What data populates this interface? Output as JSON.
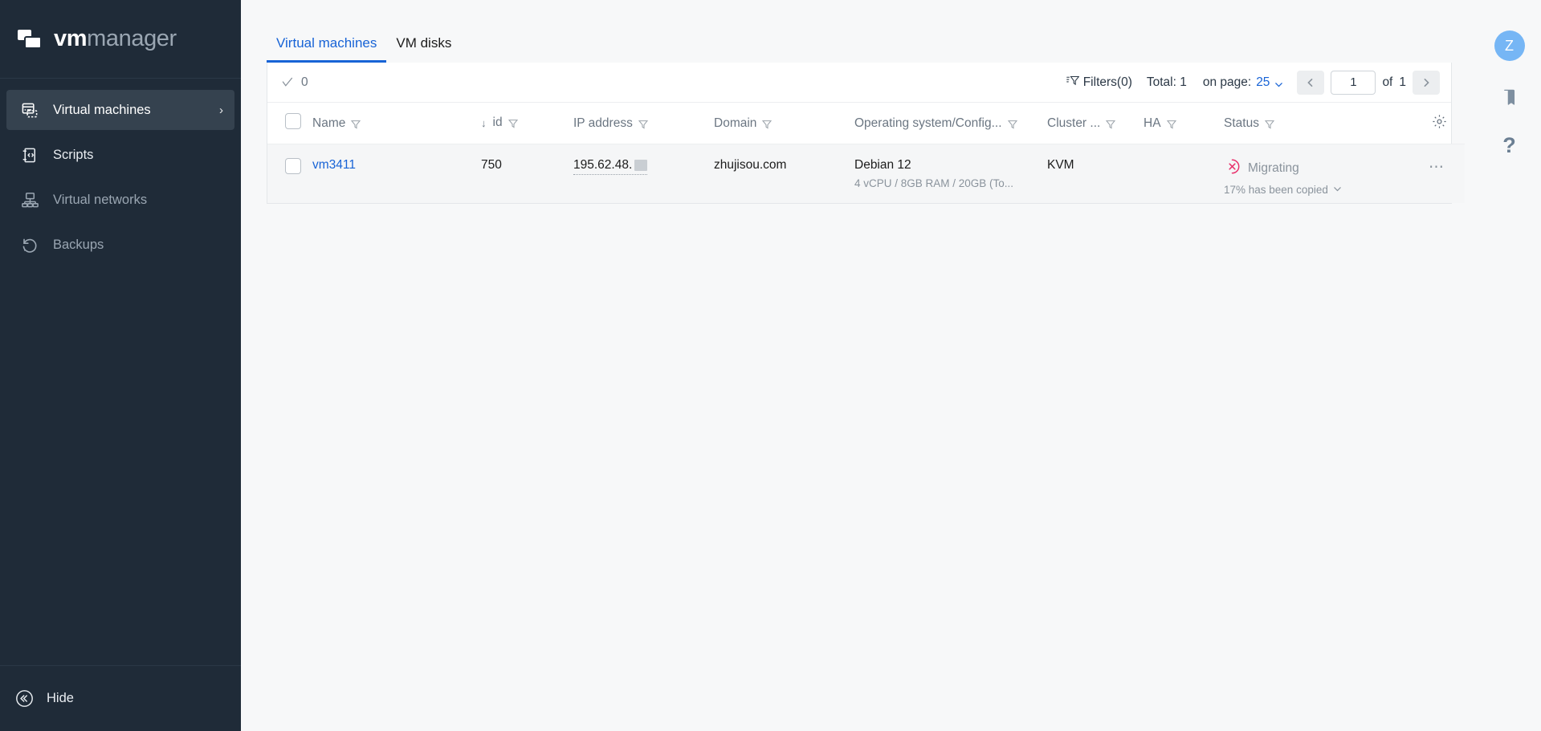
{
  "brand": {
    "name_bold": "vm",
    "name_light": "manager",
    "logo_icon": "stacked-windows-icon"
  },
  "sidebar": {
    "items": [
      {
        "label": "Virtual machines",
        "icon": "server-icon",
        "active": true,
        "chevron": "›"
      },
      {
        "label": "Scripts",
        "icon": "script-code-icon",
        "active": false
      },
      {
        "label": "Virtual networks",
        "icon": "network-nodes-icon",
        "active": false
      },
      {
        "label": "Backups",
        "icon": "restore-clock-icon",
        "active": false
      }
    ],
    "hide": {
      "label": "Hide",
      "icon": "collapse-left-icon"
    }
  },
  "tabs": [
    {
      "label": "Virtual machines",
      "active": true
    },
    {
      "label": "VM disks",
      "active": false
    }
  ],
  "toolbar": {
    "selected_count": "0",
    "select_icon": "check-icon",
    "filters_label": "Filters(0)",
    "filters_icon": "filter-lines-icon",
    "total_label": "Total: 1",
    "on_page_label": "on page:",
    "on_page_value": "25",
    "prev_icon": "chevron-left-icon",
    "next_icon": "chevron-right-icon",
    "page_value": "1",
    "of_label": "of",
    "page_count": "1"
  },
  "table": {
    "settings_icon": "gear-icon",
    "columns": [
      {
        "label": "Name",
        "filter": true
      },
      {
        "label": "id",
        "filter": true,
        "sorted": true,
        "sort_icon": "↓"
      },
      {
        "label": "IP address",
        "filter": true
      },
      {
        "label": "Domain",
        "filter": true
      },
      {
        "label": "Operating system/Config...",
        "filter": true
      },
      {
        "label": "Cluster ...",
        "filter": true
      },
      {
        "label": "HA",
        "filter": true
      },
      {
        "label": "Status",
        "filter": true
      }
    ],
    "rows": [
      {
        "name": "vm3411",
        "id": "750",
        "ip": "195.62.48.",
        "ip_redacted": true,
        "domain": "zhujisou.com",
        "os": "Debian 12",
        "config": "4 vCPU / 8GB RAM / 20GB (To...",
        "cluster": "KVM",
        "ha": "",
        "status": "Migrating",
        "status_icon": "migrating-error-icon",
        "status_color": "#e8336d",
        "status_sub": "17% has been copied",
        "status_sub_chevron": "chevron-down-icon",
        "actions_icon": "ellipsis-icon"
      }
    ]
  },
  "rail": {
    "avatar_initial": "Z",
    "avatar_color": "#76b6f5",
    "bookmark_icon": "bookmark-icon",
    "help_icon": "question-mark-icon",
    "help_glyph": "?"
  },
  "colors": {
    "sidebar_bg": "#1f2b38",
    "accent": "#1763d6",
    "page_bg": "#f7f8f9",
    "row_bg": "#f5f6f7"
  }
}
